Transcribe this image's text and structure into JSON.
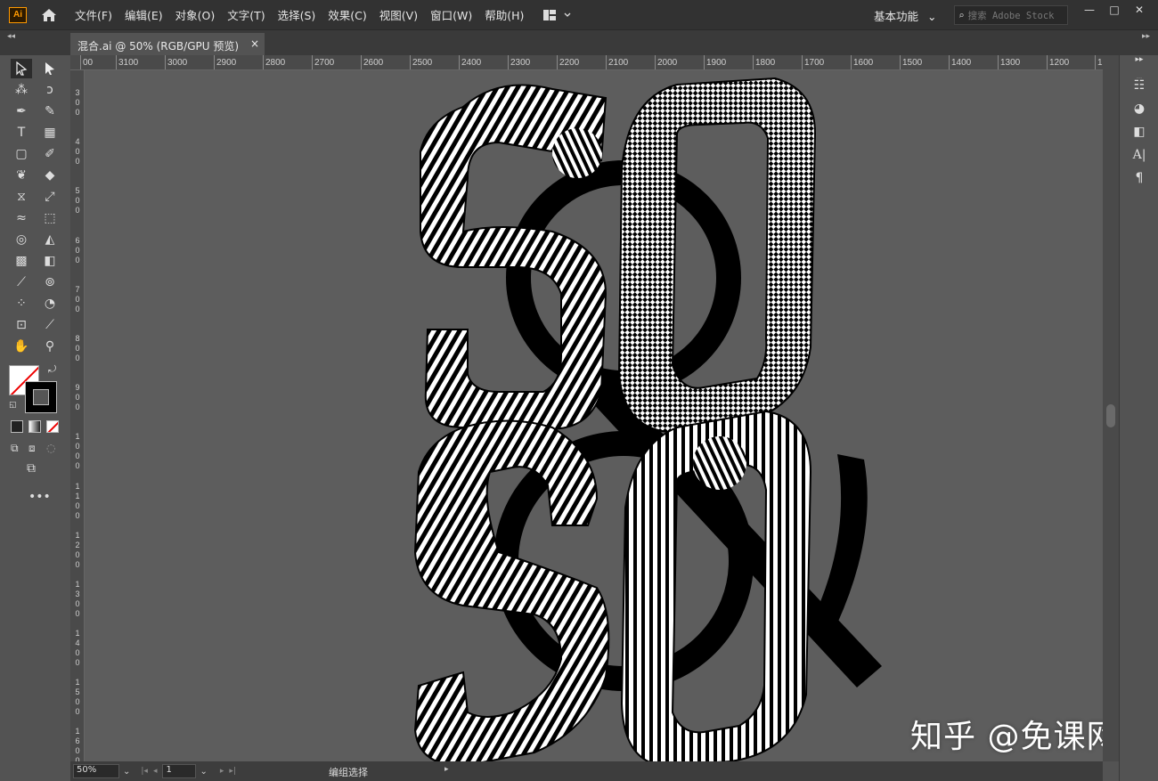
{
  "app": {
    "logo": "Ai",
    "home_icon": "home-icon",
    "layout_icon": "workspace-layout-icon"
  },
  "menu": [
    "文件(F)",
    "编辑(E)",
    "对象(O)",
    "文字(T)",
    "选择(S)",
    "效果(C)",
    "视图(V)",
    "窗口(W)",
    "帮助(H)"
  ],
  "workspace": {
    "label": "基本功能"
  },
  "search": {
    "placeholder": "搜索 Adobe Stock"
  },
  "window_controls": {
    "minimize": "—",
    "maximize": "□",
    "close": "✕"
  },
  "document": {
    "tab_title": "混合.ai @ 50% (RGB/GPU 预览)",
    "close": "×"
  },
  "ruler_top": [
    "00",
    "3100",
    "3000",
    "2900",
    "2800",
    "2700",
    "2600",
    "2500",
    "2400",
    "2300",
    "2200",
    "2100",
    "2000",
    "1900",
    "1800",
    "1700",
    "1600",
    "1500",
    "1400",
    "1300",
    "1200",
    "1"
  ],
  "ruler_left": [
    "3 0 0",
    "4 0 0",
    "5 0 0",
    "6 0 0",
    "7 0 0",
    "8 0 0",
    "9 0 0",
    "1 0 0 0",
    "1 1 0 0",
    "1 2 0 0",
    "1 3 0 0",
    "1 4 0 0",
    "1 5 0 0",
    "1 6 0 0"
  ],
  "status": {
    "zoom": "50%",
    "artboard": "1",
    "tool_status": "编组选择"
  },
  "watermark": "知乎 @免课网",
  "colors": {
    "canvas": "#5d5d5d",
    "ui_dark": "#323232",
    "panel": "#535353",
    "accent_logo": "#ff9a00"
  }
}
